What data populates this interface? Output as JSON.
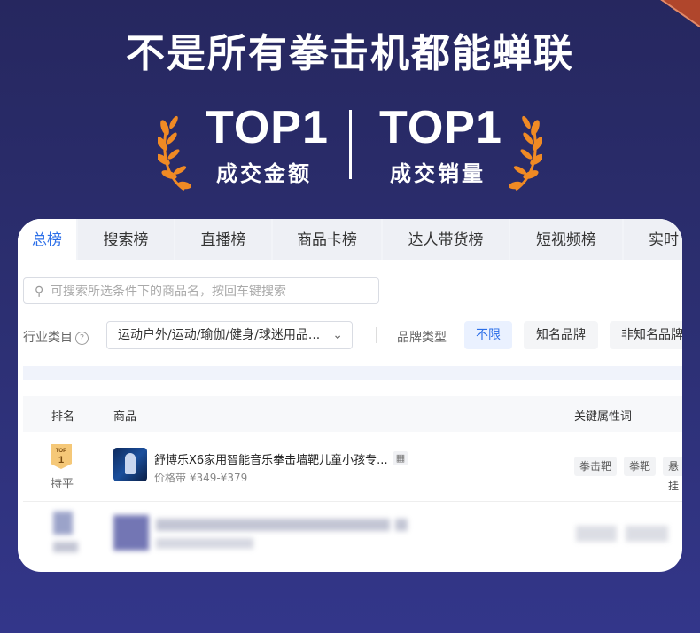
{
  "headline": "不是所有拳击机都能蝉联",
  "awards": [
    {
      "big": "TOP1",
      "small": "成交金额"
    },
    {
      "big": "TOP1",
      "small": "成交销量"
    }
  ],
  "tabs": [
    "总榜",
    "搜索榜",
    "直播榜",
    "商品卡榜",
    "达人带货榜",
    "短视频榜",
    "实时"
  ],
  "search": {
    "placeholder": "可搜索所选条件下的商品名，按回车键搜索",
    "icon": "search-icon"
  },
  "filters": {
    "industry_label": "行业类目",
    "industry_value": "运动户外/运动/瑜伽/健身/球迷用品...",
    "brand_label": "品牌类型",
    "brand_options": [
      "不限",
      "知名品牌",
      "非知名品牌"
    ]
  },
  "table": {
    "headers": {
      "rank": "排名",
      "product": "商品",
      "keywords": "关键属性词"
    },
    "rows": [
      {
        "medal": "TOP",
        "rank": "1",
        "trend": "持平",
        "name": "舒博乐X6家用智能音乐拳击墙靶儿童小孩专...",
        "price": "价格带 ¥349-¥379",
        "tags": [
          "拳击靶",
          "拳靶",
          "悬挂"
        ]
      }
    ]
  },
  "colors": {
    "accent": "#2b6ee8",
    "laurel": "#f08a24",
    "background": "#2a2c6c"
  }
}
